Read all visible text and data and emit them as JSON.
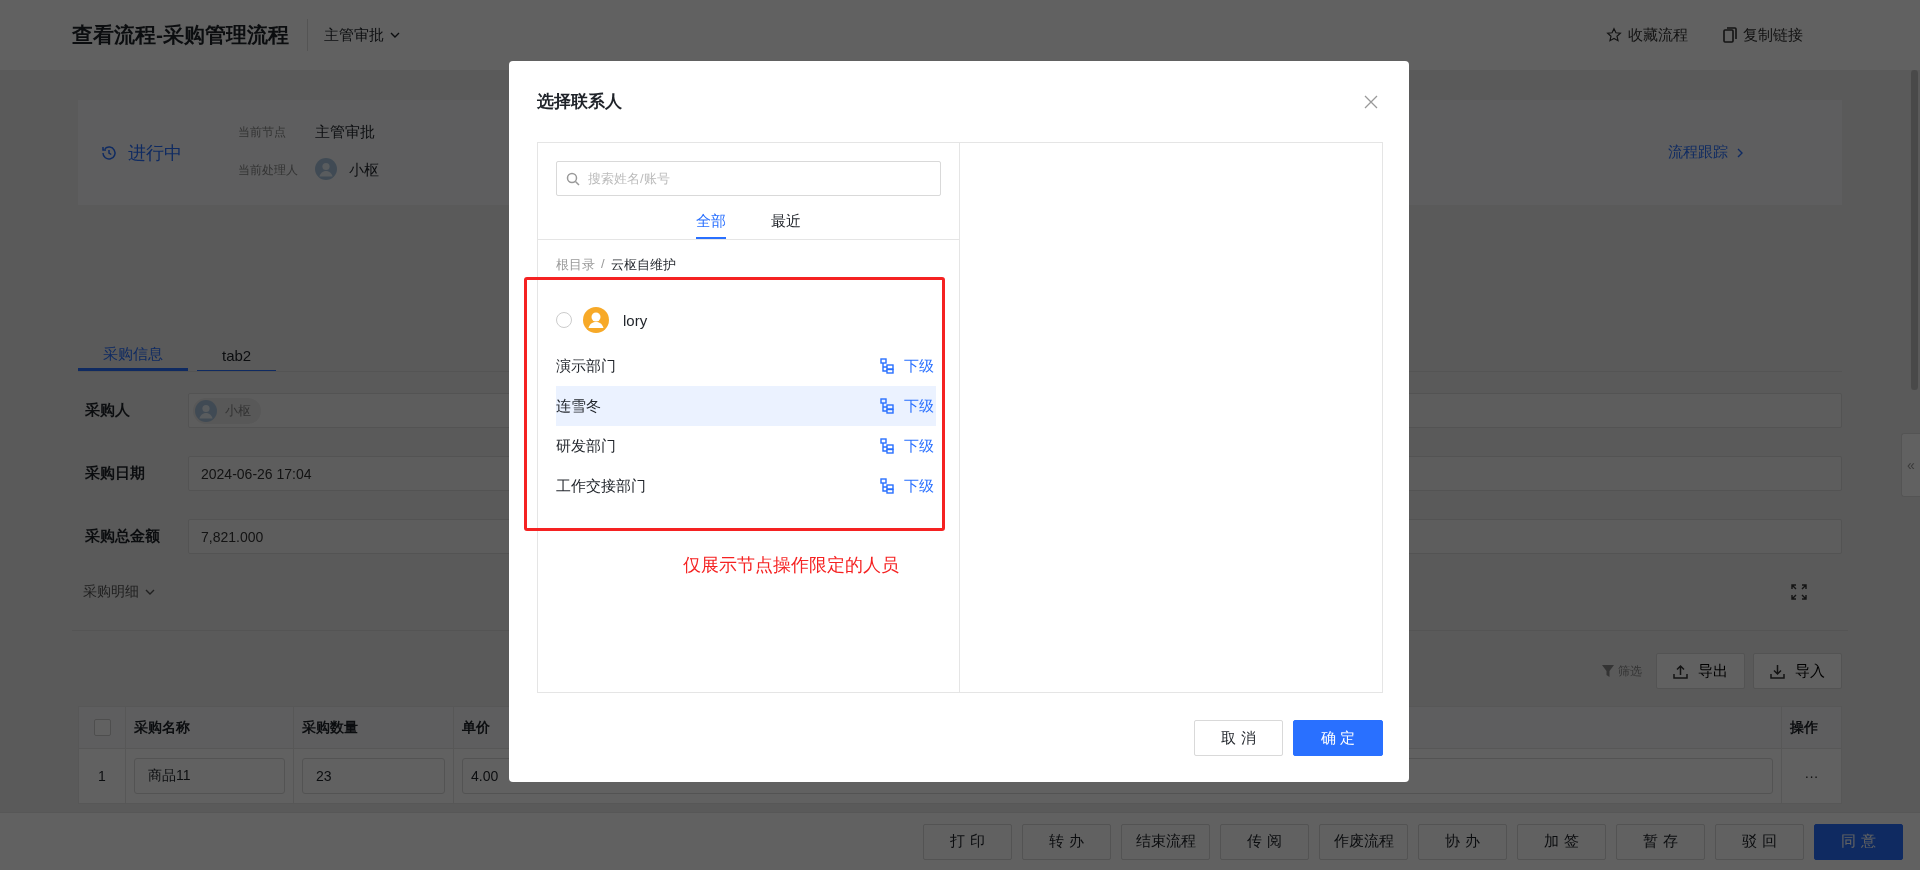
{
  "header": {
    "title": "查看流程-采购管理流程",
    "node_switch": {
      "label": "主管审批",
      "expanded": false
    },
    "actions": [
      {
        "kind": "star",
        "label": "收藏流程"
      },
      {
        "kind": "copy",
        "label": "复制链接"
      }
    ]
  },
  "status": {
    "state": "进行中",
    "current_node_label": "当前节点",
    "current_node": "主管审批",
    "handler_label": "当前处理人",
    "handler": "小枢",
    "trace_link": "流程跟踪"
  },
  "tabs": [
    {
      "label": "采购信息",
      "selected": true
    },
    {
      "label": "tab2",
      "selected": false
    }
  ],
  "form": {
    "fields": [
      {
        "kind": "person",
        "label": "采购人",
        "value": "小枢"
      },
      {
        "kind": "text",
        "label": "采购日期",
        "value": "2024-06-26 17:04"
      },
      {
        "kind": "text",
        "label": "采购总金额",
        "value": "7,821.000"
      }
    ]
  },
  "detail": {
    "title": "采购明细",
    "filter": "筛选",
    "buttons": [
      {
        "kind": "export",
        "label": "导出"
      },
      {
        "kind": "import",
        "label": "导入"
      }
    ],
    "table": {
      "select_all_checked": false,
      "columns": [
        "采购名称",
        "采购数量",
        "单价",
        "操作"
      ],
      "rows": [
        {
          "index": "1",
          "cells": [
            "商品11",
            "23",
            "4.00"
          ],
          "action": "···"
        }
      ]
    }
  },
  "footer": {
    "buttons": [
      {
        "label": "打 印",
        "primary": false
      },
      {
        "label": "转 办",
        "primary": false
      },
      {
        "label": "结束流程",
        "primary": false
      },
      {
        "label": "传 阅",
        "primary": false
      },
      {
        "label": "作废流程",
        "primary": false
      },
      {
        "label": "协 办",
        "primary": false
      },
      {
        "label": "加 签",
        "primary": false
      },
      {
        "label": "暂 存",
        "primary": false
      },
      {
        "label": "驳 回",
        "primary": false
      },
      {
        "label": "同 意",
        "primary": true
      }
    ]
  },
  "side_toggle": "«",
  "dialog": {
    "title": "选择联系人",
    "search_placeholder": "搜索姓名/账号",
    "tabs": [
      {
        "label": "全部",
        "selected": true
      },
      {
        "label": "最近",
        "selected": false
      }
    ],
    "breadcrumb": {
      "items": [
        "根目录",
        "云枢自维护"
      ],
      "separator": "/"
    },
    "items": [
      {
        "kind": "person",
        "name": "lory",
        "checked": false,
        "hovered": false
      },
      {
        "kind": "department",
        "name": "演示部门",
        "action": "下级",
        "hovered": false
      },
      {
        "kind": "department",
        "name": "连雪冬",
        "action": "下级",
        "hovered": true
      },
      {
        "kind": "department",
        "name": "研发部门",
        "action": "下级",
        "hovered": false
      },
      {
        "kind": "department",
        "name": "工作交接部门",
        "action": "下级",
        "hovered": false
      }
    ],
    "annotation": "仅展示节点操作限定的人员",
    "buttons": [
      {
        "kind": "cancel",
        "label": "取 消"
      },
      {
        "kind": "confirm",
        "label": "确 定"
      }
    ]
  }
}
